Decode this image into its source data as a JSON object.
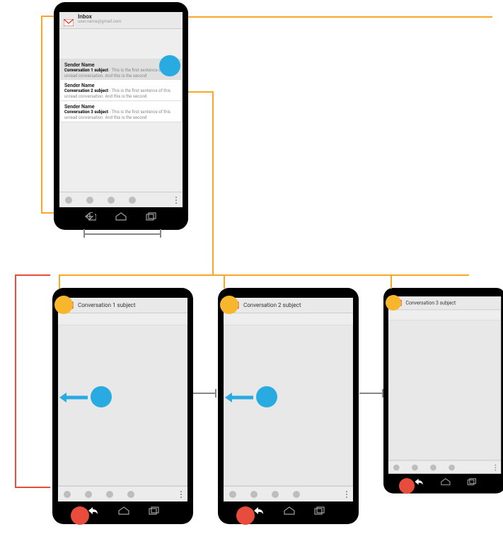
{
  "inbox": {
    "title": "Inbox",
    "subtitle": "user.name@gmail.com",
    "messages": [
      {
        "sender": "Sender Name",
        "subject": "Conversation 1 subject",
        "preview": " - This is the first sentence of this unread conversation. And this is the second"
      },
      {
        "sender": "Sender Name",
        "subject": "Conversation 2 subject",
        "preview": " - This is the first sentence of this unread conversation. And this is the second"
      },
      {
        "sender": "Sender Name",
        "subject": "Conversation 3 subject",
        "preview": " - This is the first sentence of this unread conversation. And this is the second"
      }
    ]
  },
  "detail": {
    "titles": [
      "Conversation 1 subject",
      "Conversation 2 subject",
      "Conversation 3 subject"
    ]
  },
  "captions": {
    "inbox": "",
    "d1": "",
    "d2": "",
    "d3": ""
  }
}
